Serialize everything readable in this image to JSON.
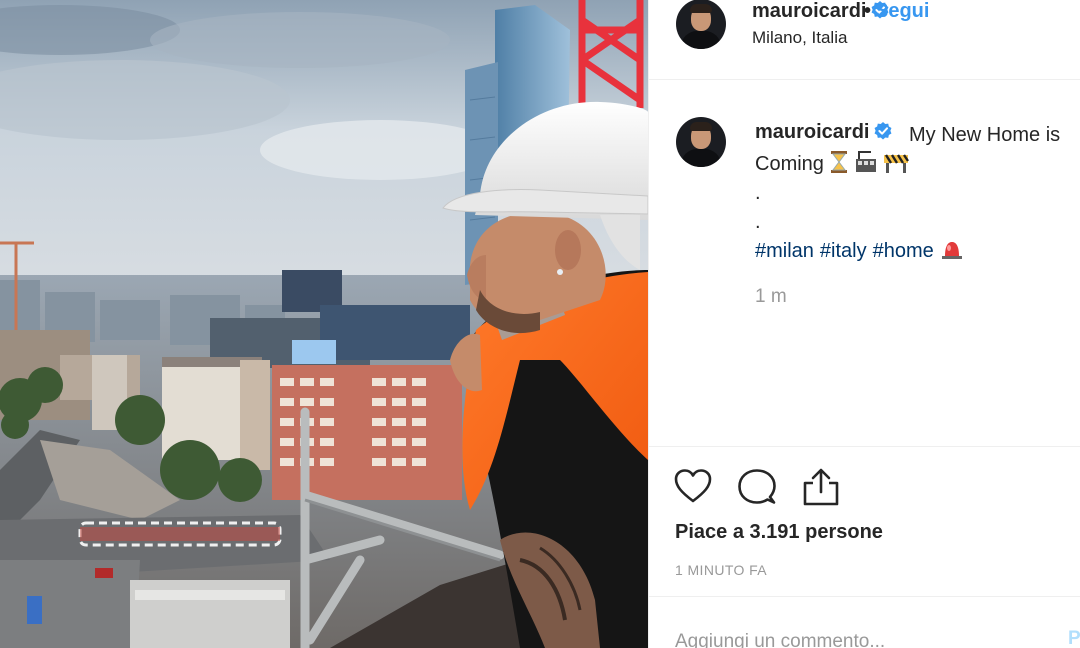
{
  "photo": {
    "description_icon": "construction-photo"
  },
  "header": {
    "username": "mauroicardi",
    "verified_icon": "verified-badge-icon",
    "separator": "•",
    "follow_label": "Segui",
    "location": "Milano, Italia"
  },
  "caption": {
    "username": "mauroicardi",
    "text_line1": "My New Home is",
    "text_line2": "Coming",
    "dot1": ".",
    "dot2": ".",
    "hashtags": [
      "#milan",
      "#italy",
      "#home"
    ],
    "time_ago": "1 m",
    "emojis": [
      "hourglass-icon",
      "construction-site-icon",
      "barrier-icon",
      "siren-icon"
    ]
  },
  "actions": {
    "like_icon": "heart-icon",
    "comment_icon": "comment-icon",
    "share_icon": "share-icon",
    "likes_text": "Piace a 3.191 persone",
    "posted_text": "1 MINUTO FA"
  },
  "comment": {
    "placeholder": "Aggiungi un commento...",
    "post_label": "P"
  },
  "colors": {
    "accent": "#3897f0",
    "hashtag": "#003569",
    "muted": "#999999",
    "vest": "#ff6a1a",
    "crane": "#e8323c"
  }
}
